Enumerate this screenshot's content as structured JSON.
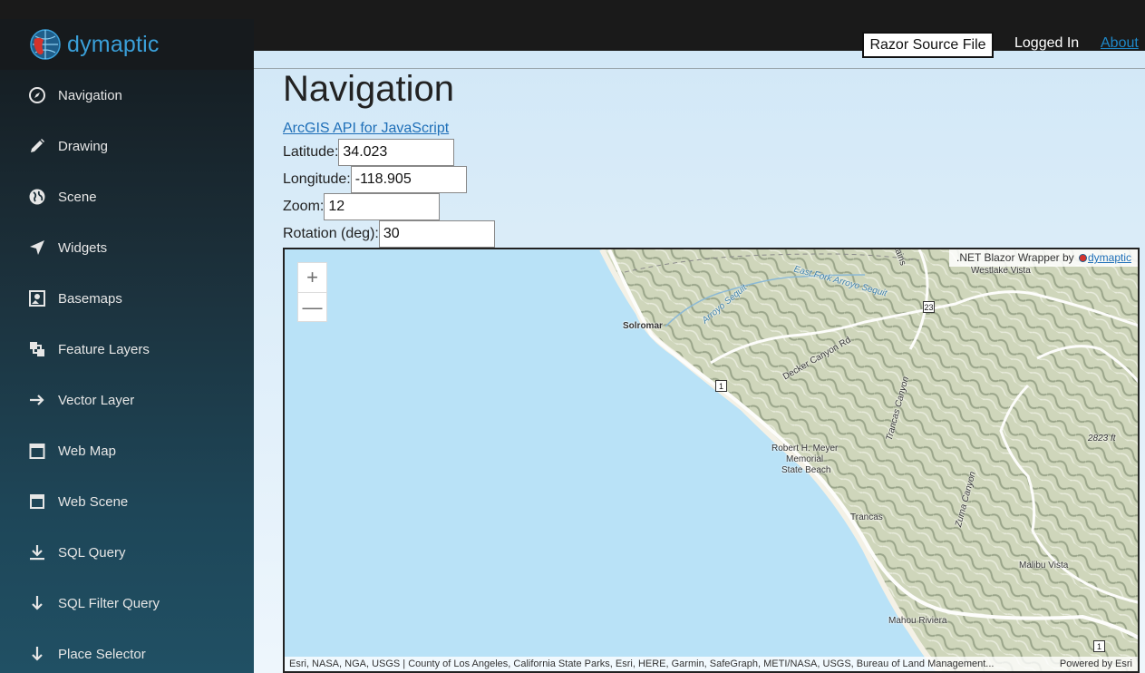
{
  "brand": {
    "name": "dymaptic"
  },
  "sidebar": {
    "items": [
      {
        "label": "Navigation",
        "icon": "compass-icon"
      },
      {
        "label": "Drawing",
        "icon": "pencil-icon"
      },
      {
        "label": "Scene",
        "icon": "globe-icon"
      },
      {
        "label": "Widgets",
        "icon": "location-arrow-icon"
      },
      {
        "label": "Basemaps",
        "icon": "map-photo-icon"
      },
      {
        "label": "Feature Layers",
        "icon": "layers-icon"
      },
      {
        "label": "Vector Layer",
        "icon": "arrow-right-icon"
      },
      {
        "label": "Web Map",
        "icon": "calendar-icon"
      },
      {
        "label": "Web Scene",
        "icon": "panel-icon"
      },
      {
        "label": "SQL Query",
        "icon": "download-icon"
      },
      {
        "label": "SQL Filter Query",
        "icon": "arrow-down-icon"
      },
      {
        "label": "Place Selector",
        "icon": "arrow-down-icon"
      }
    ]
  },
  "header": {
    "razor_button": "Razor Source File",
    "logged_in": "Logged In",
    "about": "About"
  },
  "main": {
    "title": "Navigation",
    "api_link": "ArcGIS API for JavaScript",
    "fields": {
      "latitude": {
        "label": "Latitude:",
        "value": "34.023"
      },
      "longitude": {
        "label": "Longitude:",
        "value": "-118.905"
      },
      "zoom": {
        "label": "Zoom:",
        "value": "12"
      },
      "rotation": {
        "label": "Rotation (deg):",
        "value": "30"
      }
    }
  },
  "map": {
    "zoom_in": "+",
    "zoom_out": "—",
    "wrapper_credit": ".NET Blazor Wrapper by",
    "wrapper_link": "dymaptic",
    "attribution": "Esri, NASA, NGA, USGS | County of Los Angeles, California State Parks, Esri, HERE, Garmin, SafeGraph, METI/NASA, USGS, Bureau of Land Management...",
    "powered_by": "Powered by Esri",
    "labels": {
      "westlake": "Westlake Vista",
      "solromar": "Solromar",
      "arroyo": "Arroyo Sequit",
      "east_fork": "East Fork Arroyo Sequit",
      "decker": "Decker Canyon Rd",
      "trancas_canyon": "Trancas Canyon",
      "meyer1": "Robert H. Meyer",
      "meyer2": "Memorial",
      "meyer3": "State Beach",
      "trancas": "Trancas",
      "zuma": "Zuma Canyon",
      "elev": "2823 ft",
      "malibu_vista": "Malibu Vista",
      "mahou": "Mahou Riviera",
      "rt23": "23",
      "rt1a": "1",
      "rt1b": "1",
      "mtns": "tains"
    }
  }
}
